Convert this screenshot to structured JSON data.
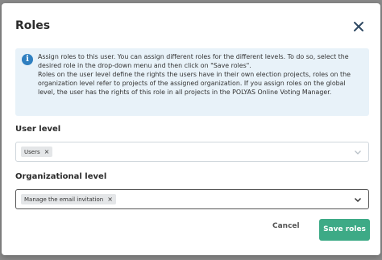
{
  "dialog": {
    "title": "Roles",
    "close_icon": "close-icon"
  },
  "info": {
    "icon": "info-icon",
    "icon_glyph": "i",
    "paragraph1": "Assign roles to this user. You can assign different roles for the different levels. To do so, select the desired role in the drop-down menu and then click on \"Save roles\".",
    "paragraph2": "Roles on the user level define the rights the users have in their own election projects, roles on the organization level refer to projects of the assigned organization. If you assign roles on the global level, the user has the rights of this role in all projects in the POLYAS Online Voting Manager."
  },
  "user_level": {
    "label": "User level",
    "selected": [
      "Users"
    ],
    "remove_glyph": "×"
  },
  "org_level": {
    "label": "Organizational level",
    "selected": [
      "Manage the email invitation"
    ],
    "remove_glyph": "×"
  },
  "footer": {
    "cancel_label": "Cancel",
    "save_label": "Save roles"
  },
  "colors": {
    "primary": "#3daa86",
    "info_bg": "#e8f2f9",
    "info_icon": "#2f7fc0"
  }
}
